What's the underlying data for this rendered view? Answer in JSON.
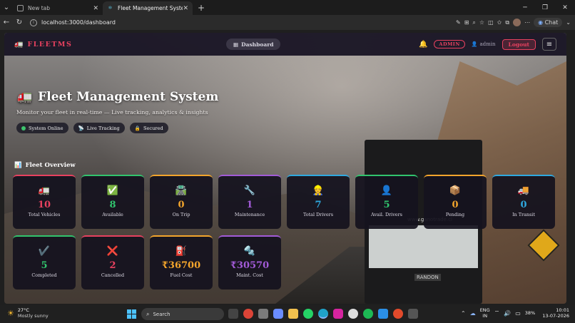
{
  "browser": {
    "tabs": [
      {
        "label": "New tab",
        "active": false
      },
      {
        "label": "Fleet Management System",
        "active": true
      }
    ],
    "url": "localhost:3000/dashboard",
    "chat_label": "Chat"
  },
  "navbar": {
    "logo": "FLEETMS",
    "dashboard_label": "Dashboard",
    "role_badge": "ADMIN",
    "username": "admin",
    "logout_label": "Logout"
  },
  "hero": {
    "title": "Fleet Management System",
    "subtitle": "Monitor your fleet in real-time — Live tracking, analytics & insights",
    "chips": [
      {
        "label": "System Online",
        "icon": "status-dot-icon"
      },
      {
        "label": "Live Tracking",
        "icon": "satellite-icon"
      },
      {
        "label": "Secured",
        "icon": "lock-icon"
      }
    ]
  },
  "overview": {
    "title": "Fleet Overview",
    "cards": [
      {
        "label": "Total Vehicles",
        "value": "10",
        "icon": "🚛",
        "color": "#e8415f",
        "name": "total-vehicles-card"
      },
      {
        "label": "Available",
        "value": "8",
        "icon": "✅",
        "color": "#31c46d",
        "name": "available-card"
      },
      {
        "label": "On Trip",
        "value": "0",
        "icon": "🛣️",
        "color": "#f3a52c",
        "name": "on-trip-card"
      },
      {
        "label": "Maintenance",
        "value": "1",
        "icon": "🔧",
        "color": "#a25bd8",
        "name": "maintenance-card"
      },
      {
        "label": "Total Drivers",
        "value": "7",
        "icon": "👷",
        "color": "#2fa9e0",
        "name": "total-drivers-card"
      },
      {
        "label": "Avail. Drivers",
        "value": "5",
        "icon": "👤",
        "color": "#31c46d",
        "name": "available-drivers-card"
      },
      {
        "label": "Pending",
        "value": "0",
        "icon": "📦",
        "color": "#f3a52c",
        "name": "pending-card"
      },
      {
        "label": "In Transit",
        "value": "0",
        "icon": "🚚",
        "color": "#2fa9e0",
        "name": "in-transit-card"
      },
      {
        "label": "Completed",
        "value": "5",
        "icon": "✔️",
        "color": "#31c46d",
        "name": "completed-card"
      },
      {
        "label": "Cancelled",
        "value": "2",
        "icon": "❌",
        "color": "#e8415f",
        "name": "cancelled-card"
      },
      {
        "label": "Fuel Cost",
        "value": "₹36700",
        "icon": "⛽",
        "color": "#f3a52c",
        "name": "fuel-cost-card"
      },
      {
        "label": "Maint. Cost",
        "value": "₹30570",
        "icon": "🔩",
        "color": "#a25bd8",
        "name": "maintenance-cost-card"
      }
    ]
  },
  "taskbar": {
    "weather_temp": "27°C",
    "weather_desc": "Mostly sunny",
    "search_placeholder": "Search",
    "lang_line1": "ENG",
    "lang_line2": "IN",
    "battery": "38%",
    "time": "10:01",
    "date": "13-07-2026"
  },
  "colors": {
    "accent": "#e8415f",
    "navbar_bg": "#18142a"
  }
}
